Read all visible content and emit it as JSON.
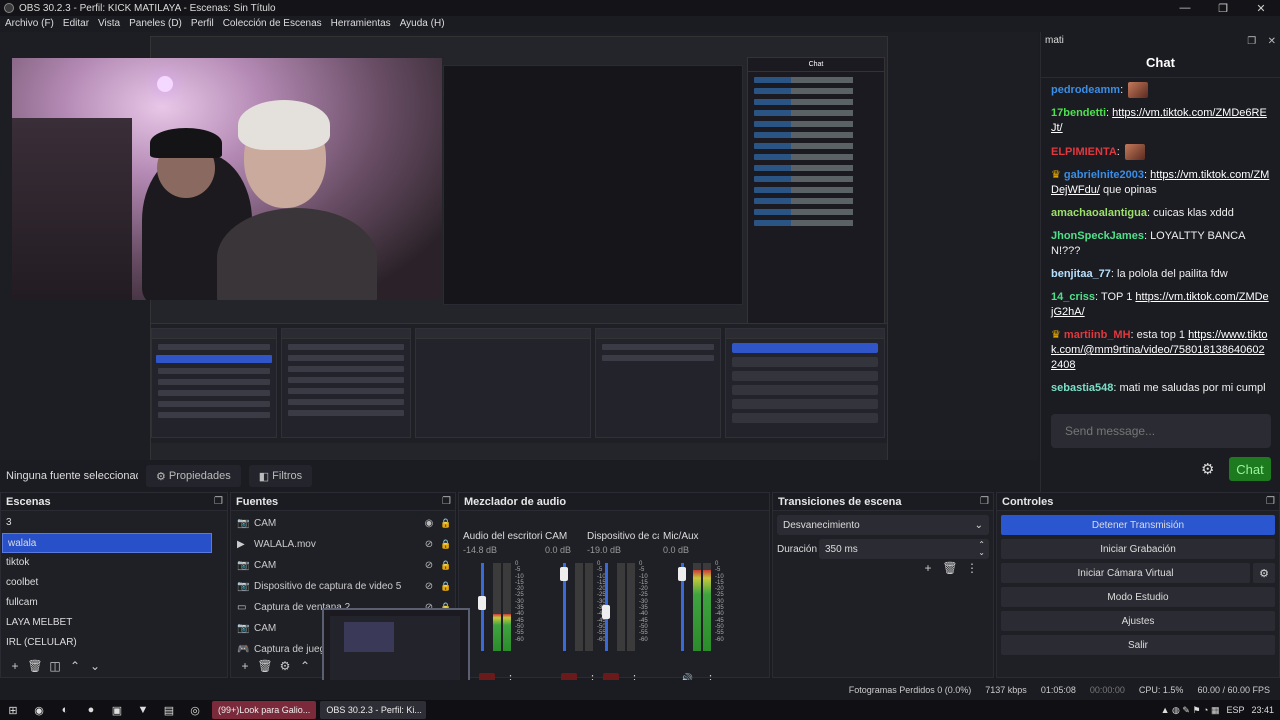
{
  "window": {
    "title": "OBS 30.2.3 - Perfil: KICK MATILAYA - Escenas: Sin Título",
    "controls": [
      "—",
      "❐",
      "✕"
    ]
  },
  "menu": [
    "Archivo (F)",
    "Editar",
    "Vista",
    "Paneles (D)",
    "Perfil",
    "Colección de Escenas",
    "Herramientas",
    "Ayuda (H)"
  ],
  "chat": {
    "dock_name": "mati",
    "header": "Chat",
    "messages": [
      {
        "user": "pedrodeamm",
        "color": "#3a8ee6",
        "text": "",
        "emote": true
      },
      {
        "user": "17bendetti",
        "color": "#4fe04f",
        "text": "",
        "link": "https://vm.tiktok.com/ZMDe6REJt/"
      },
      {
        "user": "ELPIMIENTA",
        "color": "#e0383e",
        "text": "",
        "emote": true
      },
      {
        "user": "gabrielnite2003",
        "color": "#3a8ee6",
        "crown": true,
        "link": "https://vm.tiktok.com/ZMDejWFdu/",
        "text": "que opinas"
      },
      {
        "user": "amachaoalantigua",
        "color": "#9de06a",
        "text": "cuicas klas xddd"
      },
      {
        "user": "JhonSpeckJames",
        "color": "#4fe08a",
        "text": "LOYALTTY BANCAN!???"
      },
      {
        "user": "benjitaa_77",
        "color": "#b6e0ff",
        "text": "la polola del pailita fdw"
      },
      {
        "user": "14_criss",
        "color": "#4fe08a",
        "text": "TOP 1",
        "link": "https://vm.tiktok.com/ZMDejG2hA/"
      },
      {
        "user": "martiinb_MH",
        "color": "#e0383e",
        "crown": true,
        "text": "esta top 1",
        "link": "https://www.tiktok.com/@mm9rtina/video/7580181386406022408"
      },
      {
        "user": "sebastia548",
        "color": "#7ce0c8",
        "text": "mati me saludas por mi cumpleaños plis"
      }
    ],
    "input_placeholder": "Send message...",
    "send_label": "Chat"
  },
  "source_toolbar": {
    "no_source": "Ninguna fuente seleccionada",
    "properties": "Propiedades",
    "filters": "Filtros"
  },
  "scenes": {
    "title": "Escenas",
    "items": [
      "3",
      "walala",
      "tiktok",
      "coolbet",
      "fullcam",
      "LAYA MELBET",
      "IRL (CELULAR)"
    ],
    "selected": "walala"
  },
  "sources": {
    "title": "Fuentes",
    "items": [
      {
        "icon": "camera-icon",
        "name": "CAM",
        "visible": true
      },
      {
        "icon": "play-icon",
        "name": "WALALA.mov",
        "visible": false
      },
      {
        "icon": "camera-icon",
        "name": "CAM",
        "visible": false
      },
      {
        "icon": "camera-icon",
        "name": "Dispositivo de captura de video 5",
        "visible": false
      },
      {
        "icon": "window-icon",
        "name": "Captura de ventana 2",
        "visible": false
      },
      {
        "icon": "camera-icon",
        "name": "CAM",
        "visible": false
      },
      {
        "icon": "gamepad-icon",
        "name": "Captura de juego",
        "visible": false
      }
    ]
  },
  "mixer": {
    "title": "Mezclador de audio",
    "channels": [
      {
        "name": "Audio del escritorio",
        "db": "-14.8 dB",
        "level": 0.42,
        "fader": 0.62
      },
      {
        "name": "CAM",
        "db": "0.0 dB",
        "level": 0.0,
        "fader": 0.95
      },
      {
        "name": "Dispositivo de captura",
        "db": "-19.0 dB",
        "level": 0.0,
        "fader": 0.52
      },
      {
        "name": "Mic/Aux",
        "db": "0.0 dB",
        "level": 0.92,
        "fader": 0.95
      }
    ],
    "scale": [
      "0",
      "-5",
      "-10",
      "-15",
      "-20",
      "-25",
      "-30",
      "-35",
      "-40",
      "-45",
      "-50",
      "-55",
      "-60"
    ]
  },
  "transitions": {
    "title": "Transiciones de escena",
    "selected": "Desvanecimiento",
    "duration_label": "Duración",
    "duration": "350 ms"
  },
  "controls": {
    "title": "Controles",
    "buttons": [
      "Detener Transmisión",
      "Iniciar Grabación",
      "Iniciar Cámara Virtual",
      "Modo Estudio",
      "Ajustes",
      "Salir"
    ]
  },
  "status": {
    "dropped": "Fotogramas Perdidos 0 (0.0%)",
    "bitrate": "7137 kbps",
    "stream_time": "01:05:08",
    "rec_time": "00:00:00",
    "cpu": "CPU: 1.5%",
    "fps": "60.00 / 60.00 FPS"
  },
  "taskbar": {
    "tasks": [
      "(99+)Look para Galio...",
      "OBS 30.2.3 - Perfil: Ki..."
    ],
    "lang": "ESP",
    "time": "23:41"
  },
  "colors": {
    "accent_blue": "#2a56cf",
    "chat_green": "#1e7a1e",
    "bg": "#1b1c22"
  }
}
